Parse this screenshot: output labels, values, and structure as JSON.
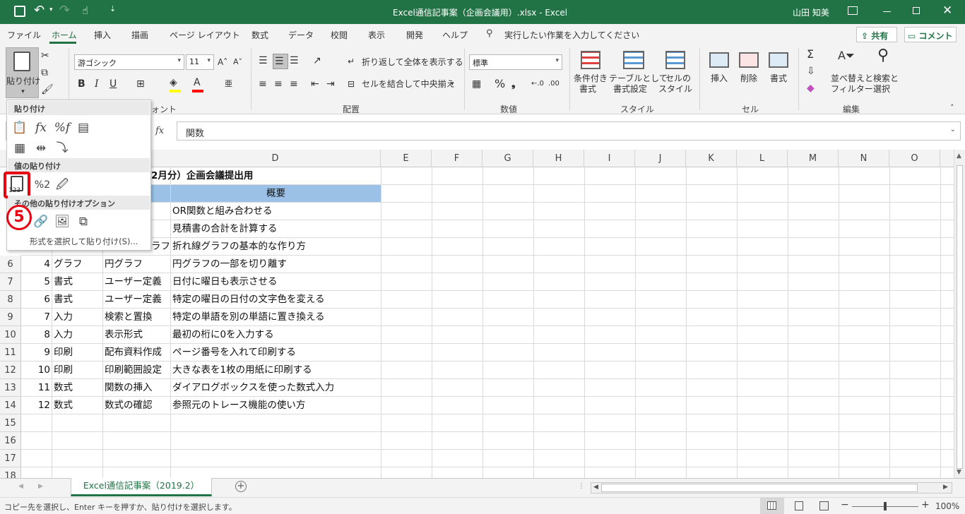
{
  "titlebar": {
    "title": "Excel通信記事案（企画会議用）.xlsx  -  Excel",
    "user": "山田 知美",
    "bg": "#217346"
  },
  "menu": {
    "tabs": [
      "ファイル",
      "ホーム",
      "挿入",
      "描画",
      "ページ レイアウト",
      "数式",
      "データ",
      "校閲",
      "表示",
      "開発",
      "ヘルプ"
    ],
    "tellme": "実行したい作業を入力してください",
    "share": "共有",
    "comment": "コメント"
  },
  "ribbon": {
    "paste_label": "貼り付け",
    "font_name": "游ゴシック",
    "font_size": "11",
    "bold": "B",
    "italic": "I",
    "underline": "U",
    "wrap_text": "折り返して全体を表示する",
    "merge_center": "セルを結合して中央揃え",
    "number_format": "標準",
    "cond_format_1": "条件付き",
    "cond_format_2": "書式",
    "format_table_1": "テーブルとして",
    "format_table_2": "書式設定",
    "cell_styles_1": "セルの",
    "cell_styles_2": "スタイル",
    "insert": "挿入",
    "delete": "削除",
    "format": "書式",
    "sort_filter_1": "並べ替えと",
    "sort_filter_2": "フィルター",
    "find_select_1": "検索と",
    "find_select_2": "選択",
    "groups": {
      "font_partial": "ォント",
      "alignment": "配置",
      "number": "数値",
      "styles": "スタイル",
      "cells": "セル",
      "editing": "編集"
    }
  },
  "formula_bar": {
    "fx": "fx",
    "content": "関数"
  },
  "columns": [
    "D",
    "E",
    "F",
    "G",
    "H",
    "I",
    "J",
    "K",
    "L",
    "M",
    "N",
    "O"
  ],
  "rows": [
    "6",
    "7",
    "8",
    "9",
    "10",
    "11",
    "12",
    "13",
    "14",
    "15",
    "16",
    "17",
    "18"
  ],
  "sheet": {
    "title_partial": "2月分）企画会議提出用",
    "header_summary": "概要",
    "summaries_top": [
      "OR関数と組み合わせる",
      "見積書の合計を計算する"
    ],
    "row5_c": "ラフ",
    "row5_d": "折れ線グラフの基本的な作り方",
    "rows": [
      {
        "a": "4",
        "b": "グラフ",
        "c": "円グラフ",
        "d": "円グラフの一部を切り離す"
      },
      {
        "a": "5",
        "b": "書式",
        "c": "ユーザー定義",
        "d": "日付に曜日も表示させる"
      },
      {
        "a": "6",
        "b": "書式",
        "c": "ユーザー定義",
        "d": "特定の曜日の日付の文字色を変える"
      },
      {
        "a": "7",
        "b": "入力",
        "c": "検索と置換",
        "d": "特定の単語を別の単語に置き換える"
      },
      {
        "a": "8",
        "b": "入力",
        "c": "表示形式",
        "d": "最初の桁に0を入力する"
      },
      {
        "a": "9",
        "b": "印刷",
        "c": "配布資料作成",
        "d": "ページ番号を入れて印刷する"
      },
      {
        "a": "10",
        "b": "印刷",
        "c": "印刷範囲設定",
        "d": "大きな表を1枚の用紙に印刷する"
      },
      {
        "a": "11",
        "b": "数式",
        "c": "関数の挿入",
        "d": "ダイアログボックスを使った数式入力"
      },
      {
        "a": "12",
        "b": "数式",
        "c": "数式の確認",
        "d": "参照元のトレース機能の使い方"
      }
    ]
  },
  "paste_menu": {
    "section_paste": "貼り付け",
    "section_values": "値の貼り付け",
    "section_other": "その他の貼り付けオプション",
    "values_num": "123",
    "values_pct": "%2",
    "paste_special": "形式を選択して貼り付け(S)...",
    "callout": "5",
    "accent": "#e60012"
  },
  "sheet_tab": "Excel通信記事案（2019.2）",
  "status": {
    "message": "コピー先を選択し、Enter キーを押すか、貼り付けを選択します。",
    "zoom": "100%"
  }
}
